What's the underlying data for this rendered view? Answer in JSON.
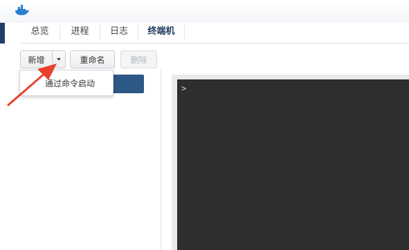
{
  "tabs": [
    {
      "label": "总览"
    },
    {
      "label": "进程"
    },
    {
      "label": "日志"
    },
    {
      "label": "终端机"
    }
  ],
  "active_tab": "终端机",
  "toolbar": {
    "new_label": "新增",
    "rename_label": "重命名",
    "delete_label": "删除"
  },
  "dropdown": {
    "item_label": "通过命令启动"
  },
  "terminal": {
    "prompt": ">"
  },
  "colors": {
    "terminal_bg": "#2e2e2e",
    "selected_item": "#2d5784",
    "annotation_arrow": "#e8412d",
    "active_tab_text": "#1e3a5f"
  },
  "icons": {
    "logo": "docker-whale-icon",
    "dropdown_caret": "caret-down-icon"
  }
}
